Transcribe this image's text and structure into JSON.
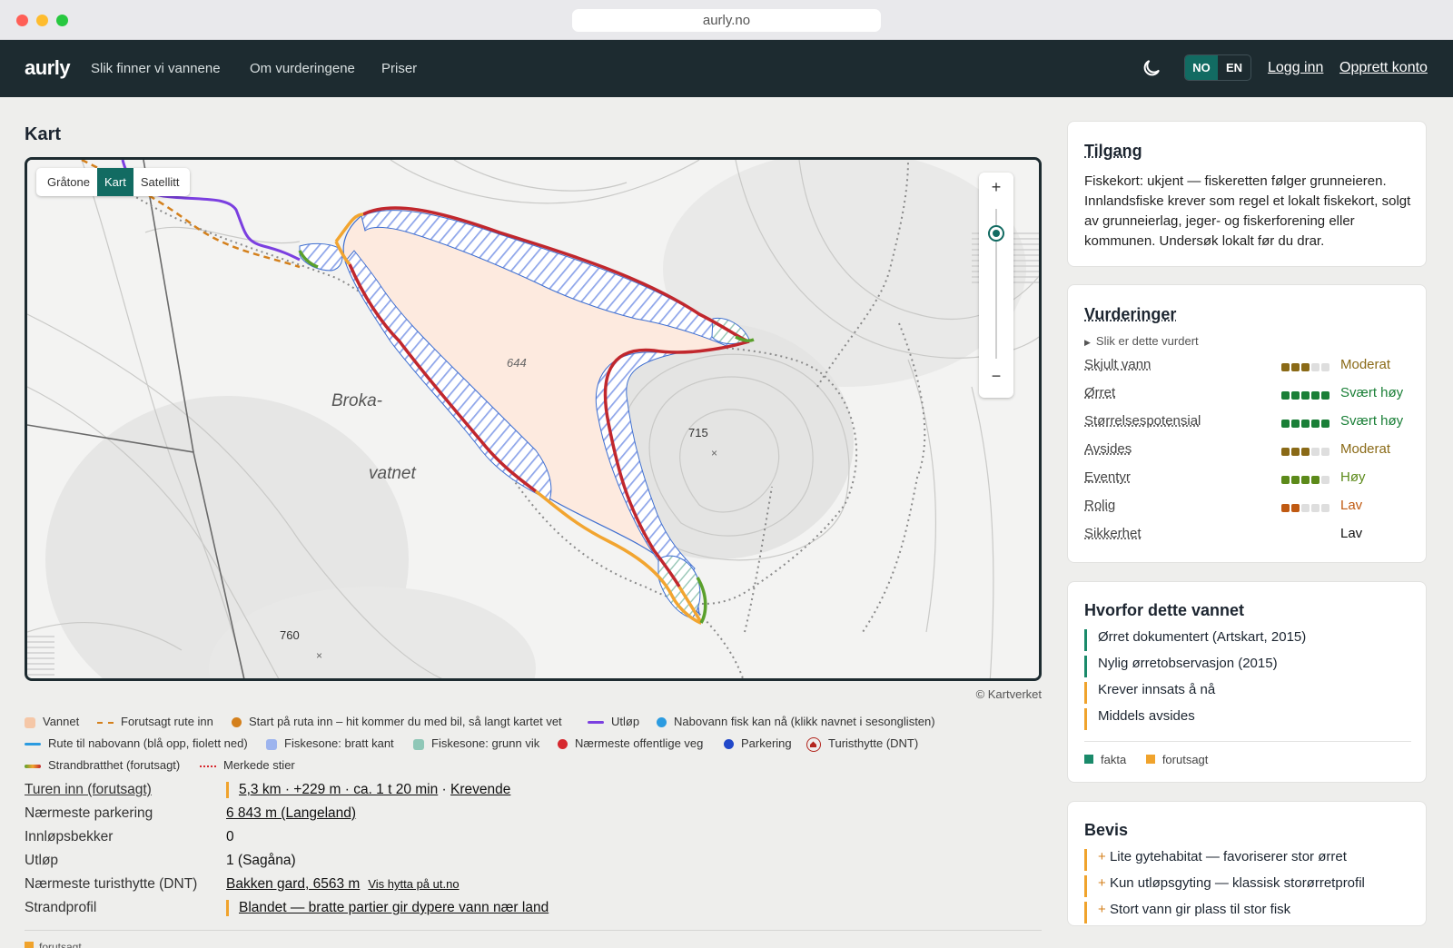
{
  "browser": {
    "url": "aurly.no"
  },
  "nav": {
    "logo": "aurly",
    "links": [
      "Slik finner vi vannene",
      "Om vurderingene",
      "Priser"
    ],
    "lang": [
      "NO",
      "EN"
    ],
    "login": "Logg inn",
    "signup": "Opprett konto"
  },
  "map": {
    "heading": "Kart",
    "toggle": [
      "Gråtone",
      "Kart",
      "Satellitt"
    ],
    "active_toggle": "Kart",
    "zoom_in": "+",
    "zoom_out": "−",
    "labels": {
      "lake_elev": "644",
      "name1": "Broka-",
      "name2": "vatnet",
      "hill1": "715",
      "hill2": "760"
    },
    "copyright": "© Kartverket"
  },
  "legend": [
    {
      "label": "Vannet",
      "swatch": "#f5c7a7"
    },
    {
      "label": "Forutsagt rute inn",
      "swatch": "#d4801c"
    },
    {
      "label": "Start på ruta inn – hit kommer du med bil, så langt kartet vet",
      "swatch": "#d4801c"
    },
    {
      "label": "Utløp",
      "swatch": "#7b3fe0"
    },
    {
      "label": "Nabovann fisk kan nå (klikk navnet i sesonglisten)",
      "swatch": "#2b9be0"
    },
    {
      "label": "Rute til nabovann (blå opp, fiolett ned)",
      "swatch": "#2b9be0"
    },
    {
      "label": "Fiskesone: bratt kant",
      "swatch": "#9db4ee"
    },
    {
      "label": "Fiskesone: grunn vik",
      "swatch": "#8fc7b7"
    },
    {
      "label": "Nærmeste offentlige veg",
      "swatch": "#d6282e"
    },
    {
      "label": "Parkering",
      "swatch": "#2148c9"
    },
    {
      "label": "Turisthytte (DNT)",
      "swatch": "#b3261e"
    },
    {
      "label": "Strandbratthet (forutsagt)",
      "swatch": "#d4801c"
    },
    {
      "label": "Merkede stier",
      "swatch": "#d6282e"
    }
  ],
  "facts": {
    "route_label": "Turen inn (forutsagt)",
    "route_value": "5,3 km · +229 m · ca. 1 t 20 min",
    "route_sep": " · ",
    "route_difficulty": "Krevende",
    "parking_label": "Nærmeste parkering",
    "parking_value": "6 843 m (Langeland)",
    "inlets_label": "Innløpsbekker",
    "inlets_value": "0",
    "outlet_label": "Utløp",
    "outlet_value": "1 (Sagåna)",
    "hut_label": "Nærmeste turisthytte (DNT)",
    "hut_value": "Bakken gard, 6563 m",
    "hut_link": "Vis hytta på ut.no",
    "shore_label": "Strandprofil",
    "shore_value": "Blandet — bratte partier gir dypere vann nær land",
    "footnote": "forutsagt"
  },
  "access": {
    "title": "Tilgang",
    "text": "Fiskekort: ukjent — fiskeretten følger grunneieren. Innlandsfiske krever som regel et lokalt fiskekort, solgt av grunneierlag, jeger- og fiskerforening eller kommunen. Undersøk lokalt før du drar."
  },
  "ratings": {
    "title": "Vurderinger",
    "how": "Slik er dette vurdert",
    "rows": [
      {
        "label": "Skjult vann",
        "level": 3,
        "value": "Moderat",
        "color": "#8a6a17"
      },
      {
        "label": "Ørret",
        "level": 5,
        "value": "Svært høy",
        "color": "#1a7f37"
      },
      {
        "label": "Størrelsespotensial",
        "level": 5,
        "value": "Svært høy",
        "color": "#1a7f37"
      },
      {
        "label": "Avsides",
        "level": 3,
        "value": "Moderat",
        "color": "#8a6a17"
      },
      {
        "label": "Eventyr",
        "level": 4,
        "value": "Høy",
        "color": "#5c8a1a"
      },
      {
        "label": "Rolig",
        "level": 2,
        "value": "Lav",
        "color": "#c05a12"
      },
      {
        "label": "Sikkerhet",
        "level": 0,
        "value": "Lav",
        "color": "#111111"
      }
    ]
  },
  "why": {
    "title": "Hvorfor dette vannet",
    "items": [
      {
        "text": "Ørret dokumentert (Artskart, 2015)",
        "kind": "fakta"
      },
      {
        "text": "Nylig ørretobservasjon (2015)",
        "kind": "fakta"
      },
      {
        "text": "Krever innsats å nå",
        "kind": "forutsagt"
      },
      {
        "text": "Middels avsides",
        "kind": "forutsagt"
      }
    ],
    "key_fact": "fakta",
    "key_pred": "forutsagt",
    "color_fact": "#1a8a6a",
    "color_pred": "#f0a32c"
  },
  "evidence": {
    "title": "Bevis",
    "items": [
      "Lite gytehabitat — favoriserer stor ørret",
      "Kun utløpsgyting — klassisk storørretprofil",
      "Stort vann gir plass til stor fisk"
    ]
  }
}
